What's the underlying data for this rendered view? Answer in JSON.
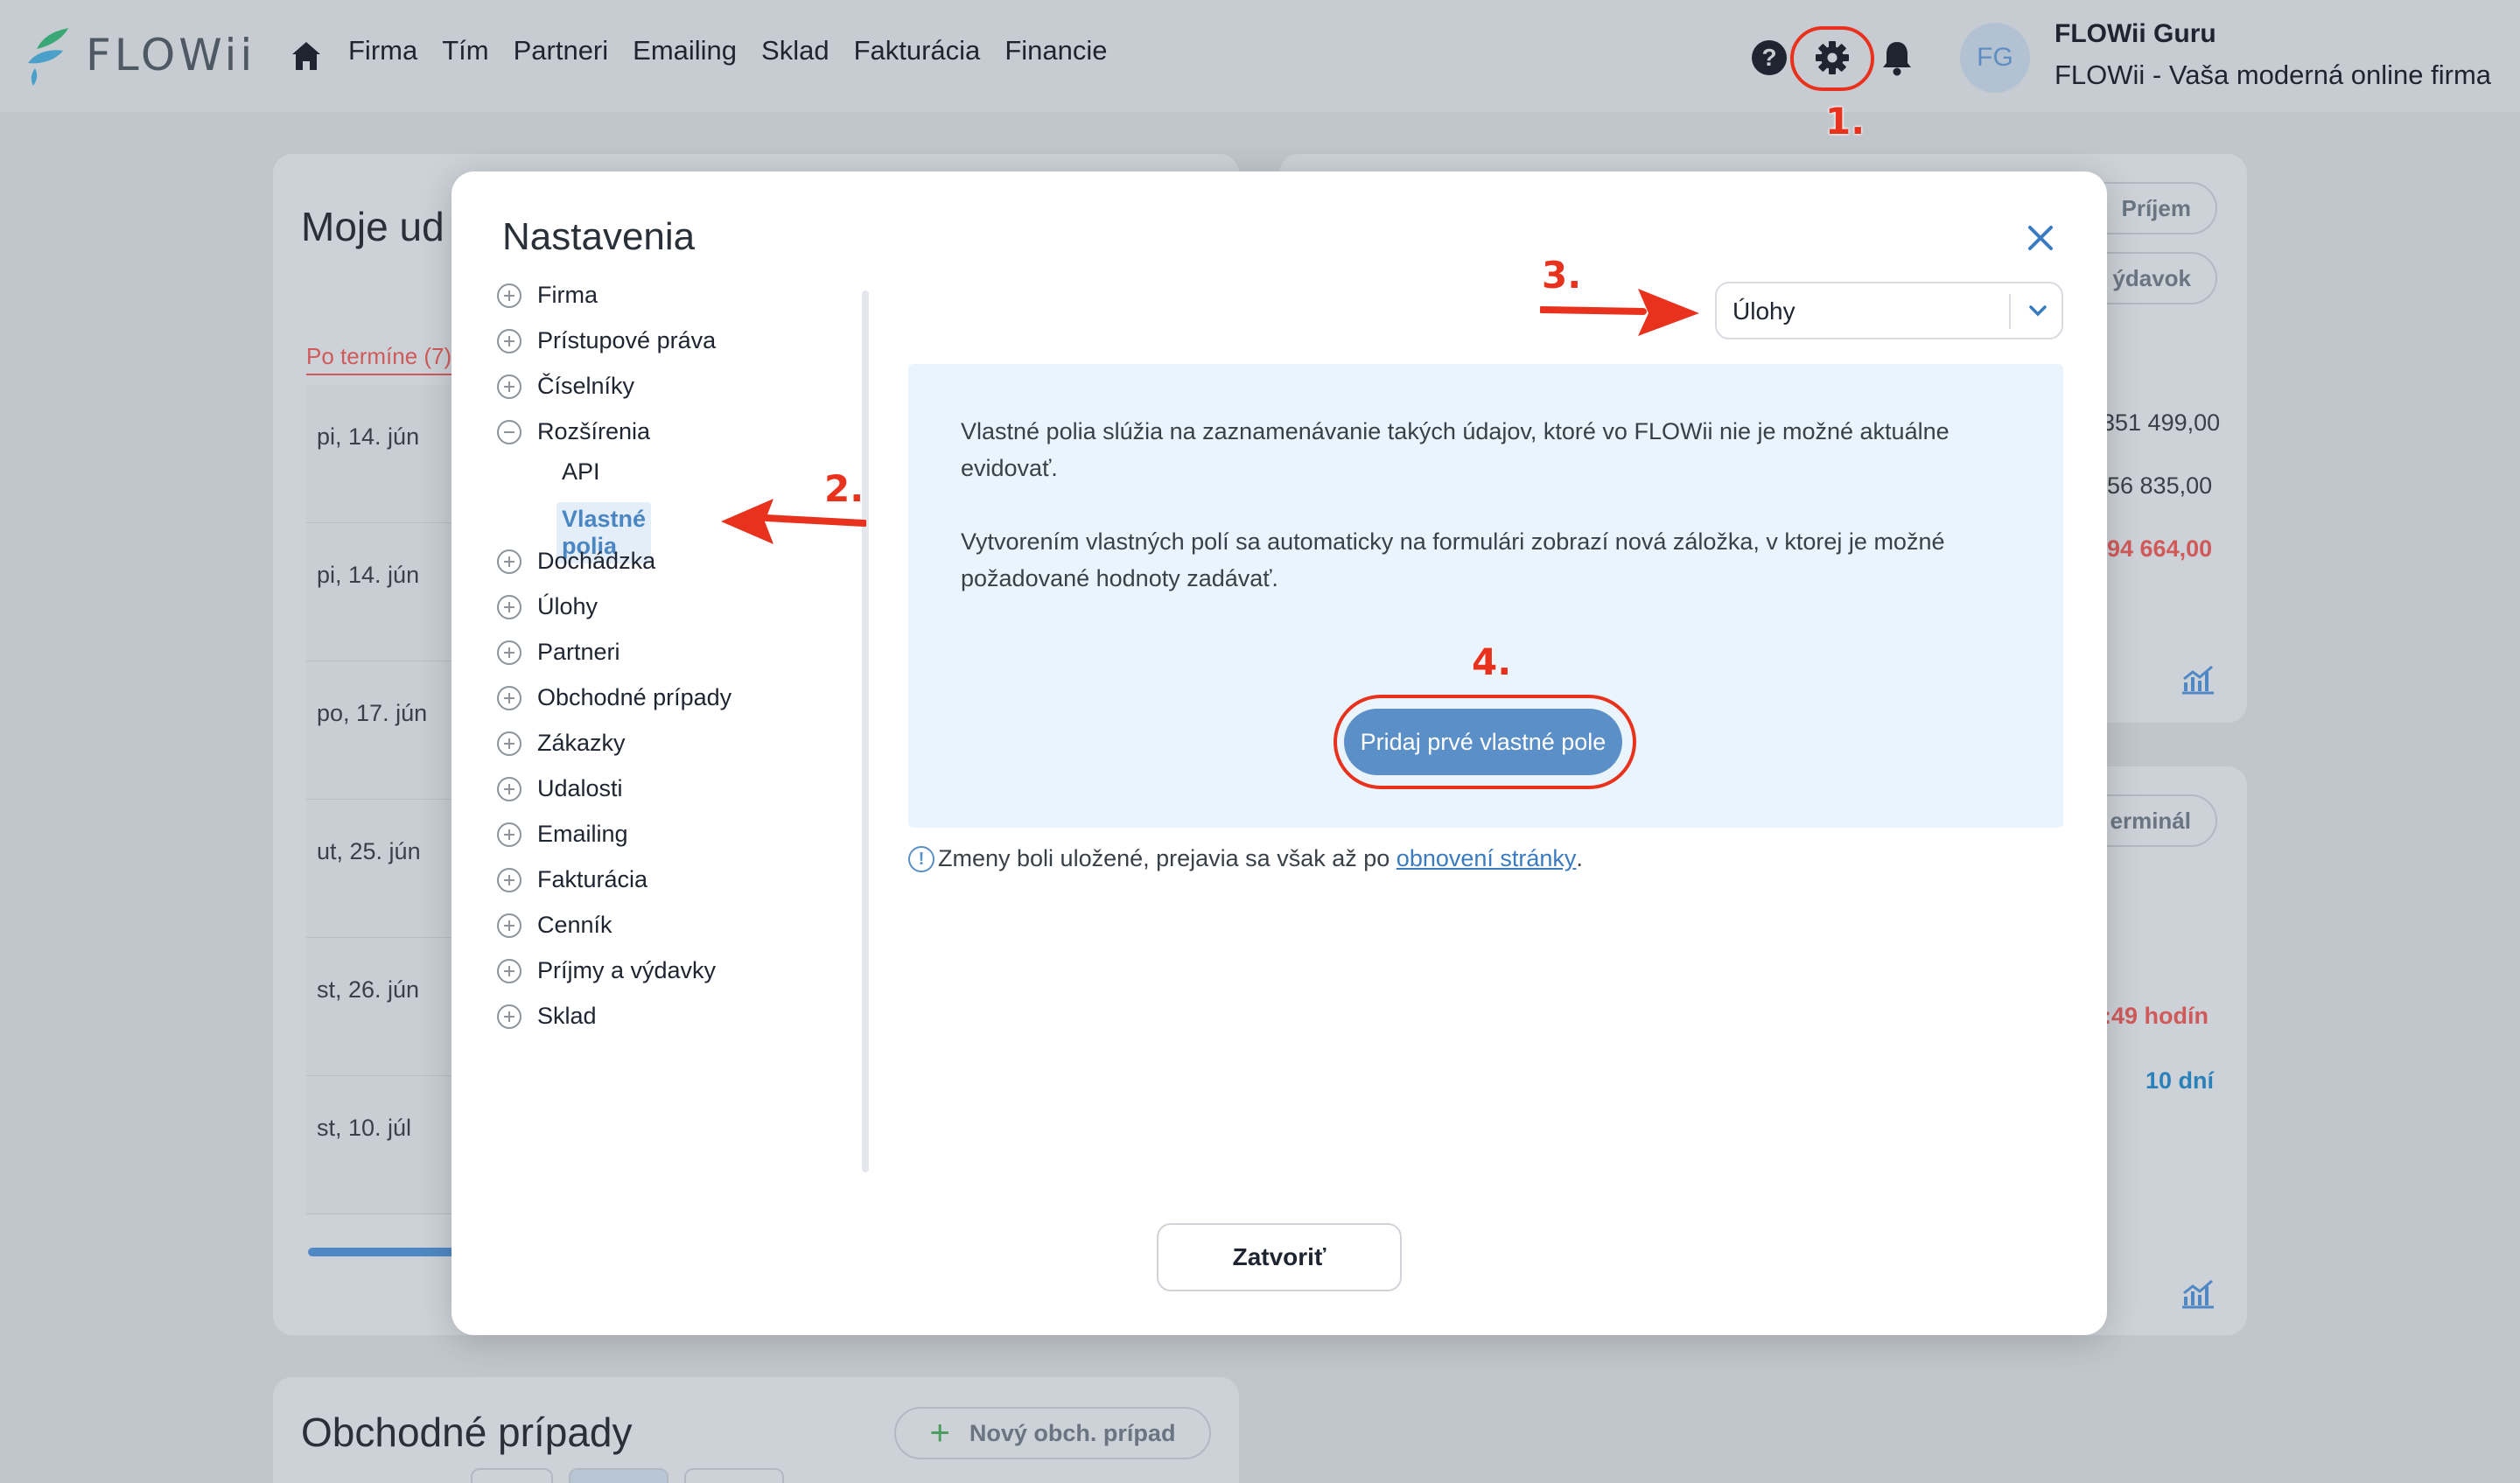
{
  "app": {
    "logo_text": "FLOWii",
    "nav": [
      "Firma",
      "Tím",
      "Partneri",
      "Emailing",
      "Sklad",
      "Fakturácia",
      "Financie"
    ],
    "user": {
      "initials": "FG",
      "name": "FLOWii Guru",
      "company": "FLOWii - Vaša moderná online firma"
    }
  },
  "background": {
    "left_card_title": "Moje ud",
    "po_termine": "Po termíne (7)",
    "dates": [
      "pi, 14. jún",
      "pi, 14. jún",
      "po, 17. jún",
      "ut, 25. jún",
      "st, 26. jún",
      "st, 10. júl"
    ],
    "right_pills": [
      "Príjem",
      "ýdavok",
      "erminál"
    ],
    "right_values": [
      "351 499,00",
      "56 835,00",
      "94 664,00"
    ],
    "right_red": ":49 hodín",
    "right_blue": "10 dní",
    "obch_title": "Obchodné prípady",
    "new_obch_label": "Nový obch. prípad"
  },
  "modal": {
    "title": "Nastavenia",
    "tree": [
      {
        "label": "Firma",
        "expanded": false
      },
      {
        "label": "Prístupové práva",
        "expanded": false
      },
      {
        "label": "Číselníky",
        "expanded": false
      },
      {
        "label": "Rozšírenia",
        "expanded": true
      },
      {
        "label": "Dochádzka",
        "expanded": false
      },
      {
        "label": "Úlohy",
        "expanded": false
      },
      {
        "label": "Partneri",
        "expanded": false
      },
      {
        "label": "Obchodné prípady",
        "expanded": false
      },
      {
        "label": "Zákazky",
        "expanded": false
      },
      {
        "label": "Udalosti",
        "expanded": false
      },
      {
        "label": "Emailing",
        "expanded": false
      },
      {
        "label": "Fakturácia",
        "expanded": false
      },
      {
        "label": "Cenník",
        "expanded": false
      },
      {
        "label": "Príjmy a výdavky",
        "expanded": false
      },
      {
        "label": "Sklad",
        "expanded": false
      }
    ],
    "sub_items": [
      "API",
      "Vlastné polia"
    ],
    "select_value": "Úlohy",
    "info_p1": "Vlastné polia slúžia na zaznamenávanie takých údajov, ktoré vo FLOWii nie je možné aktuálne evidovať.",
    "info_p2": "Vytvorením vlastných polí sa automaticky na formulári zobrazí nová záložka, v ktorej je možné požadované hodnoty zadávať.",
    "add_button": "Pridaj prvé vlastné pole",
    "notice_text": "Zmeny boli uložené, prejavia sa však až po",
    "notice_link": "obnovení stránky",
    "notice_end": ".",
    "close_button": "Zatvoriť"
  },
  "annotations": {
    "step1": "1.",
    "step2": "2.",
    "step3": "3.",
    "step4": "4."
  },
  "colors": {
    "accent": "#5b8fc7",
    "annotation": "#e8321e",
    "danger": "#d05a5a"
  }
}
